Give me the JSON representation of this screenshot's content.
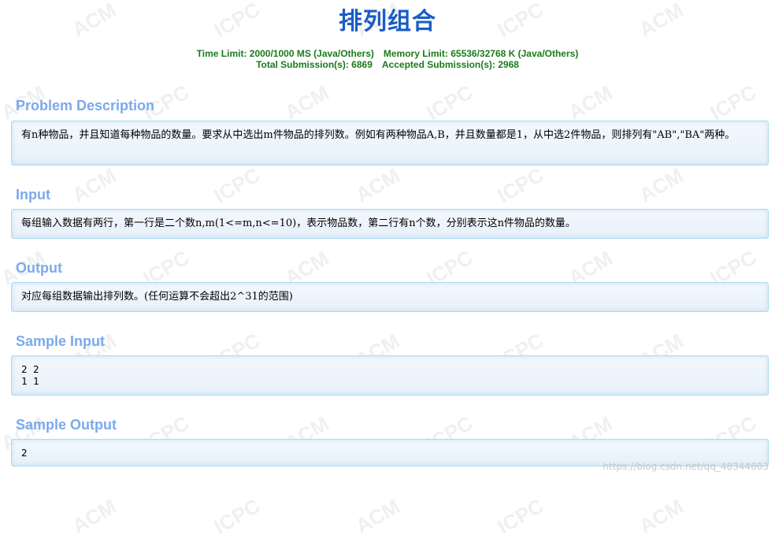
{
  "problem": {
    "title": "排列组合",
    "time_limit": "Time Limit: 2000/1000 MS (Java/Others)",
    "memory_limit": "Memory Limit: 65536/32768 K (Java/Others)",
    "total_submissions": "Total Submission(s): 6869",
    "accepted_submissions": "Accepted Submission(s): 2968"
  },
  "sections": {
    "description": {
      "heading": "Problem Description",
      "text": "有n种物品，并且知道每种物品的数量。要求从中选出m件物品的排列数。例如有两种物品A,B，并且数量都是1，从中选2件物品，则排列有\"AB\",\"BA\"两种。"
    },
    "input": {
      "heading": "Input",
      "text": "每组输入数据有两行，第一行是二个数n,m(1<=m,n<=10)，表示物品数，第二行有n个数，分别表示这n件物品的数量。"
    },
    "output": {
      "heading": "Output",
      "text": "对应每组数据输出排列数。(任何运算不会超出2^31的范围)"
    },
    "sample_input": {
      "heading": "Sample Input",
      "text": "2 2\n1 1"
    },
    "sample_output": {
      "heading": "Sample Output",
      "text": "2"
    }
  },
  "watermark": {
    "word_acm": "ACM",
    "word_icpc": "ICPC",
    "credit": "https://blog.csdn.net/qq_48344603"
  },
  "colors": {
    "title": "#1a5cc8",
    "limits": "#1a7a1a",
    "section_heading": "#7ca9ed",
    "panel_border": "#a8dcf2",
    "panel_background": "#eaf2fb"
  }
}
